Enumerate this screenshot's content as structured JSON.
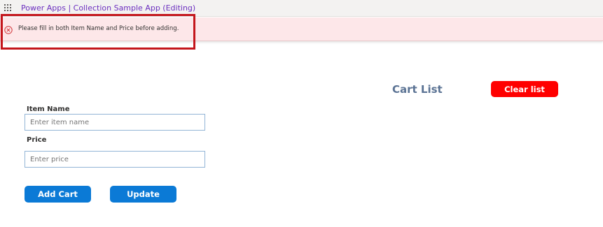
{
  "header": {
    "title": "Power Apps  |  Collection Sample App (Editing)",
    "menu_icon": "waffle-grid-icon"
  },
  "notification": {
    "icon": "error-circle-icon",
    "message": "Please fill in both Item Name and Price before adding.",
    "colors": {
      "background": "#fde7e9",
      "icon": "#d13438",
      "highlight_border": "#c4161c"
    }
  },
  "cart": {
    "title": "Cart List",
    "clear_label": "Clear list",
    "clear_color": "#ff0000"
  },
  "form": {
    "item_name_label": "Item Name",
    "item_name_placeholder": "Enter item name",
    "item_name_value": "",
    "price_label": "Price",
    "price_placeholder": "Enter price",
    "price_value": "",
    "add_label": "Add Cart",
    "update_label": "Update",
    "button_color": "#0b7ad6"
  }
}
